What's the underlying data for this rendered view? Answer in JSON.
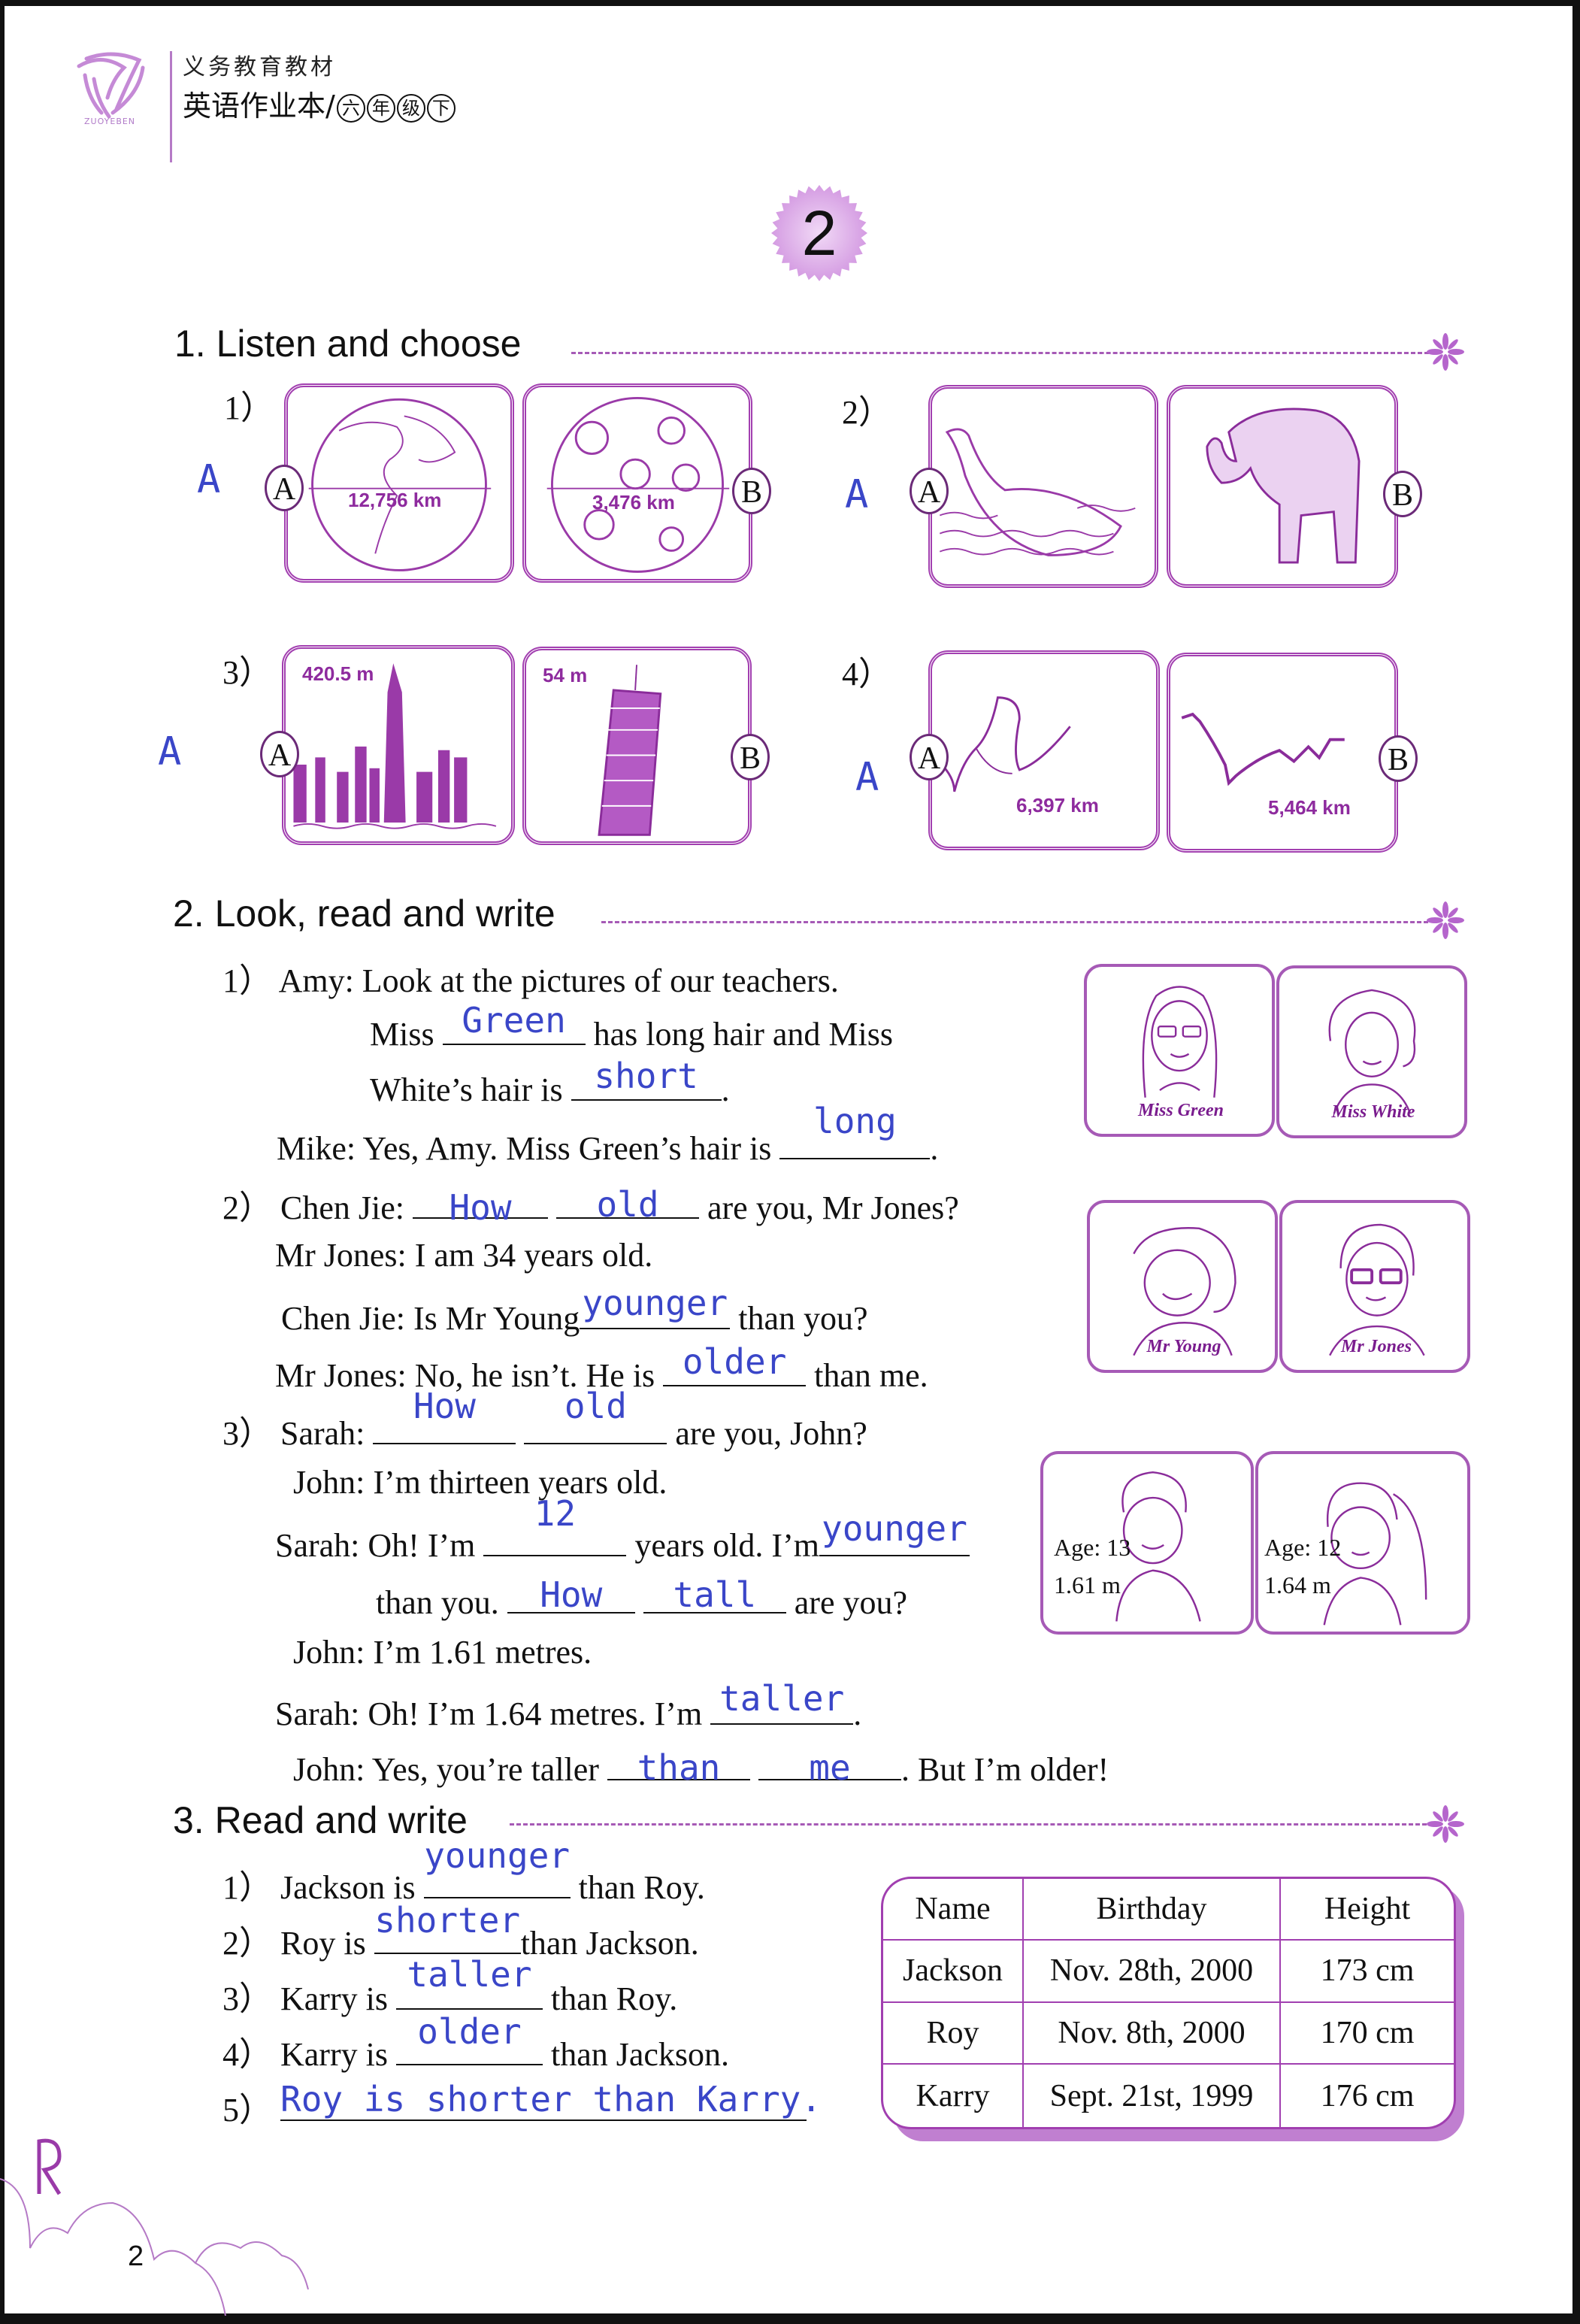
{
  "header": {
    "series": "义务教育教材",
    "book_title": "英语作业本",
    "separator": "/",
    "grade_chars": [
      "六",
      "年",
      "级",
      "下"
    ],
    "logo_text": "ZUOYEBEN"
  },
  "unit": {
    "number": "2"
  },
  "colors": {
    "accent": "#a23fb0",
    "handwriting": "#3a46c8",
    "text": "#111111"
  },
  "section1": {
    "title": "1. Listen and choose",
    "items": [
      {
        "num": "1）",
        "answer": "A",
        "option_a": {
          "letter": "A",
          "picture": "earth-illustration",
          "label": "12,756 km"
        },
        "option_b": {
          "letter": "B",
          "picture": "moon-illustration",
          "label": "3,476 km"
        }
      },
      {
        "num": "2）",
        "answer": "A",
        "option_a": {
          "letter": "A",
          "picture": "whale-illustration",
          "label": ""
        },
        "option_b": {
          "letter": "B",
          "picture": "elephant-illustration",
          "label": ""
        }
      },
      {
        "num": "3）",
        "answer": "A",
        "option_a": {
          "letter": "A",
          "picture": "skyscraper-city-illustration",
          "label": "420.5 m"
        },
        "option_b": {
          "letter": "B",
          "picture": "leaning-tower-illustration",
          "label": "54 m"
        }
      },
      {
        "num": "4）",
        "answer": "A",
        "option_a": {
          "letter": "A",
          "picture": "river-map-a",
          "label": "6,397 km"
        },
        "option_b": {
          "letter": "B",
          "picture": "river-map-b",
          "label": "5,464 km"
        }
      }
    ]
  },
  "section2": {
    "title": "2. Look, read and write",
    "q1": {
      "num": "1）",
      "l1": "Amy: Look at the pictures of our teachers.",
      "l2_pre": "Miss",
      "l2_ans": "Green",
      "l2_post": "has long hair and Miss",
      "l3_pre": "White’s hair is",
      "l3_ans": "short",
      "l3_post": ".",
      "l4_pre": "Mike: Yes, Amy. Miss Green’s hair is",
      "l4_ans": "long",
      "l4_post": "."
    },
    "q2": {
      "num": "2）",
      "l1_pre": "Chen Jie:",
      "l1_ans1": "How",
      "l1_ans2": "old",
      "l1_post": "are you, Mr Jones?",
      "l2": "Mr Jones: I am 34 years old.",
      "l3_pre": "Chen Jie: Is Mr Young",
      "l3_ans": "younger",
      "l3_post": "than you?",
      "l4_pre": "Mr Jones: No, he isn’t. He is",
      "l4_ans": "older",
      "l4_post": "than me."
    },
    "q3": {
      "num": "3）",
      "l1_pre": "Sarah:",
      "l1_ans1": "How",
      "l1_ans2": "old",
      "l1_post": "are you, John?",
      "l2": "John: I’m thirteen years old.",
      "l3_pre": "Sarah: Oh! I’m",
      "l3_ans1": "12",
      "l3_mid": "years old. I’m",
      "l3_ans2": "younger",
      "l4_pre": "than you.",
      "l4_ans1": "How",
      "l4_ans2": "tall",
      "l4_post": "are you?",
      "l5": "John: I’m 1.61 metres.",
      "l6_pre": "Sarah: Oh! I’m 1.64 metres. I’m",
      "l6_ans": "taller",
      "l6_post": ".",
      "l7_pre": "John: Yes, you’re taller",
      "l7_ans1": "than",
      "l7_ans2": "me",
      "l7_post": ". But I’m older!"
    },
    "portraits": [
      {
        "name": "Miss Green"
      },
      {
        "name": "Miss White"
      },
      {
        "name": "Mr Young"
      },
      {
        "name": "Mr Jones"
      }
    ],
    "kids": [
      {
        "age": "Age: 13",
        "height": "1.61 m"
      },
      {
        "age": "Age: 12",
        "height": "1.64 m"
      }
    ]
  },
  "section3": {
    "title": "3. Read and write",
    "items": [
      {
        "num": "1）",
        "pre": "Jackson is",
        "ans": "younger",
        "post": "than Roy."
      },
      {
        "num": "2）",
        "pre": "Roy is",
        "ans": "shorter",
        "post": "than Jackson."
      },
      {
        "num": "3）",
        "pre": "Karry is",
        "ans": "taller",
        "post": "than Roy."
      },
      {
        "num": "4）",
        "pre": "Karry is",
        "ans": "older",
        "post": "than Jackson."
      },
      {
        "num": "5）",
        "pre": "",
        "ans": "Roy is shorter than Karry.",
        "post": ""
      }
    ],
    "table": {
      "headers": [
        "Name",
        "Birthday",
        "Height"
      ],
      "rows": [
        [
          "Jackson",
          "Nov. 28th, 2000",
          "173 cm"
        ],
        [
          "Roy",
          "Nov. 8th, 2000",
          "170 cm"
        ],
        [
          "Karry",
          "Sept. 21st, 1999",
          "176 cm"
        ]
      ]
    }
  },
  "footer": {
    "page_number": "2"
  }
}
